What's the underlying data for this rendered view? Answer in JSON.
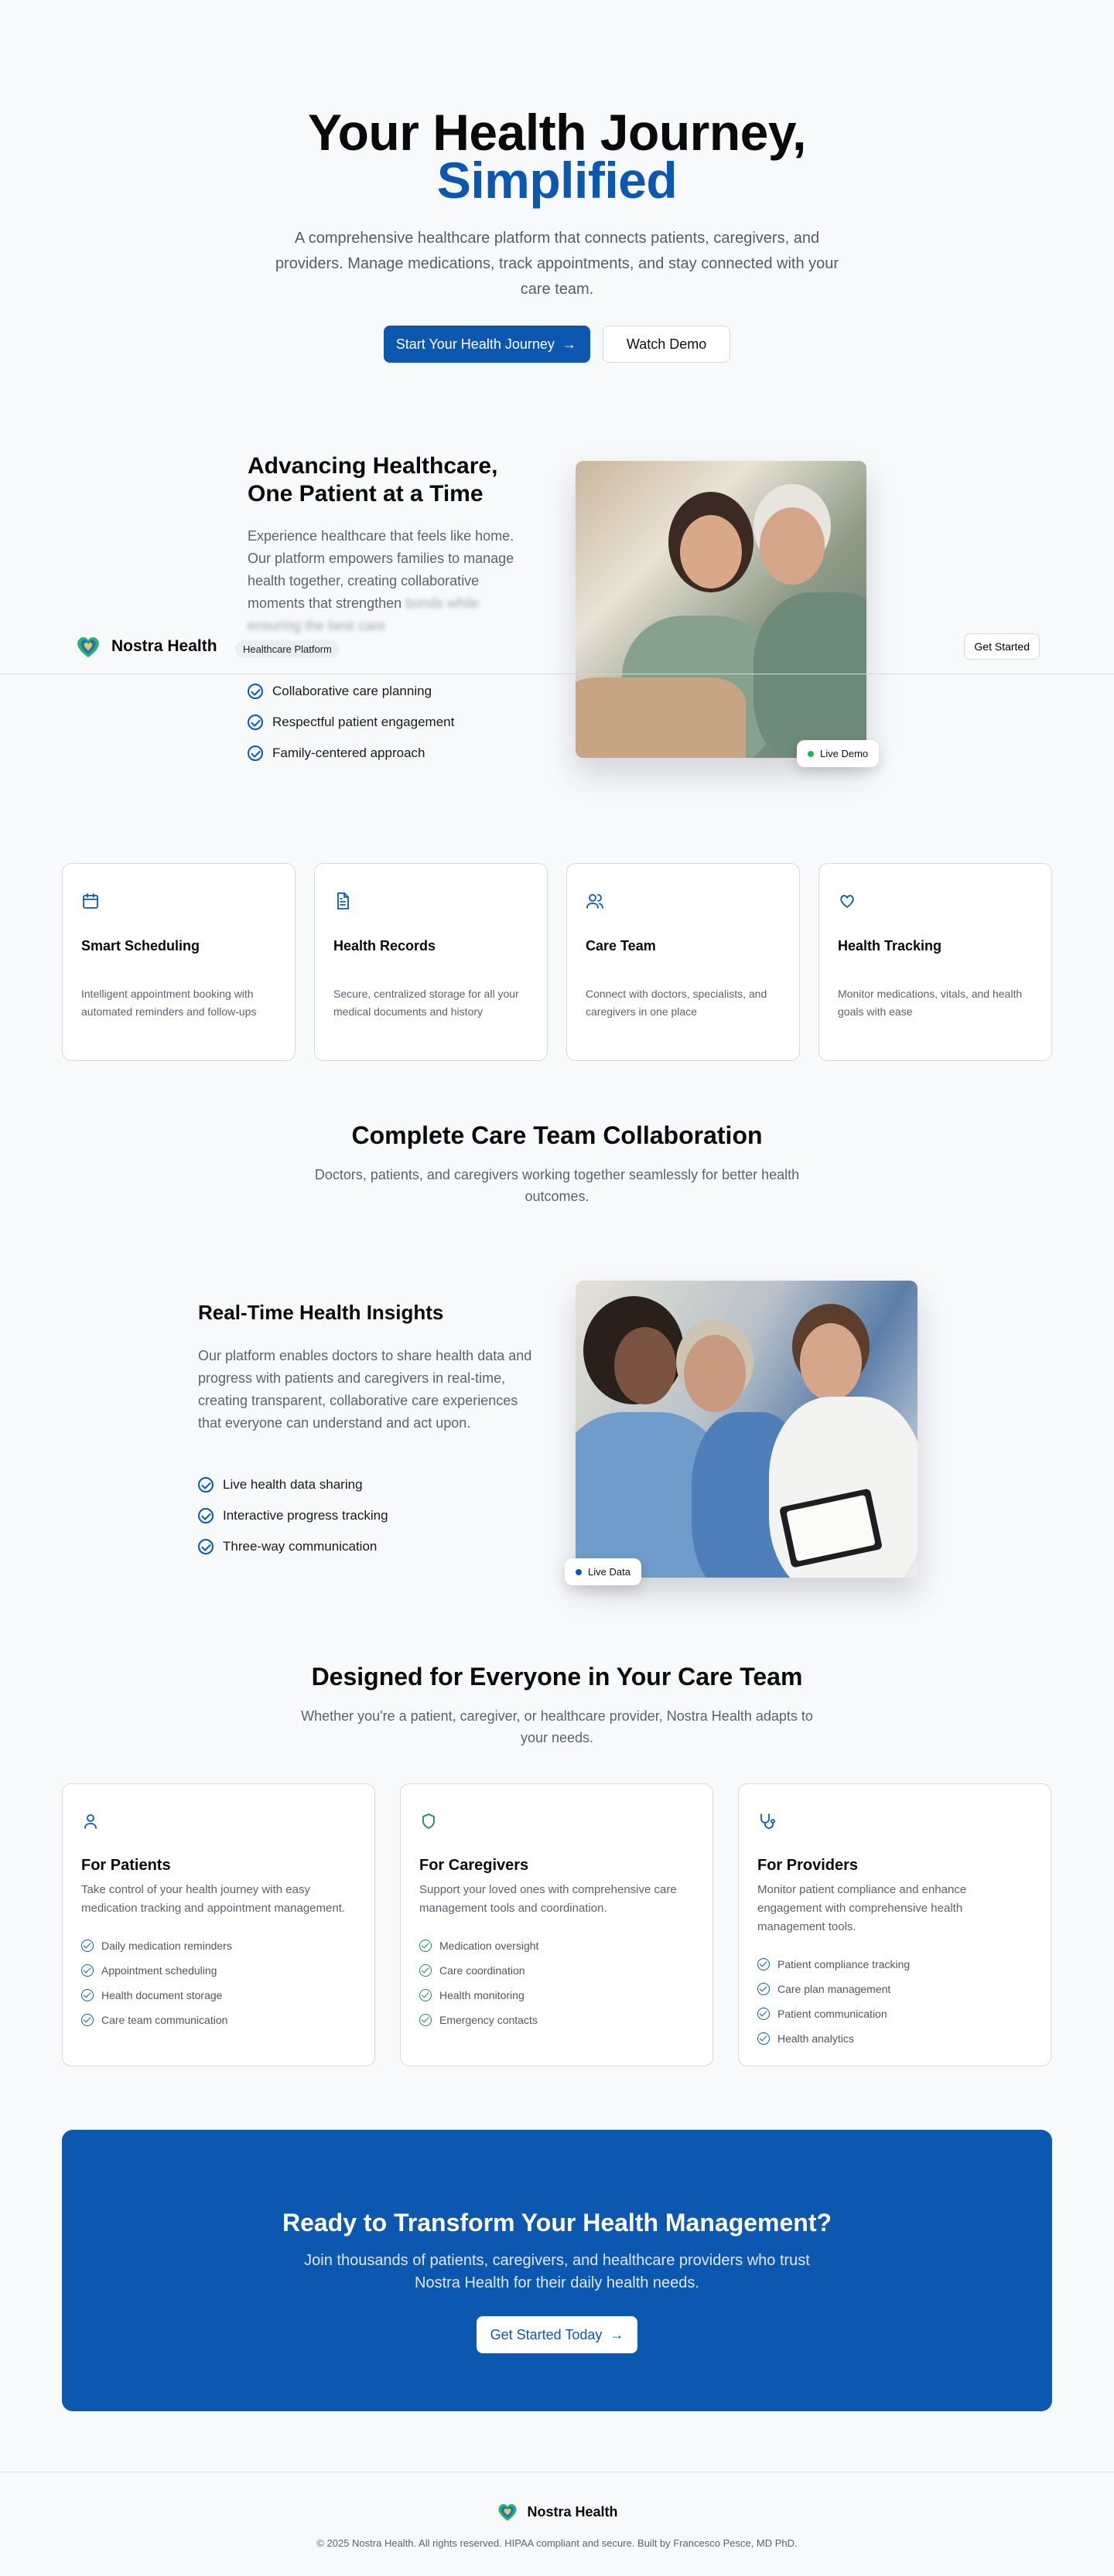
{
  "colors": {
    "accent": "#0c58b0",
    "live_green": "#22b35e",
    "check_green": "#1f8a56"
  },
  "hero": {
    "title_line1": "Your Health Journey,",
    "title_line2": "Simplified",
    "subtitle": "A comprehensive healthcare platform that connects patients, caregivers, and providers. Manage medications, track appointments, and stay connected with your care team.",
    "primary_cta": "Start Your Health Journey",
    "secondary_cta": "Watch Demo"
  },
  "nav": {
    "brand": "Nostra Health",
    "badge": "Healthcare Platform",
    "get_started": "Get Started"
  },
  "advancing": {
    "title": "Advancing Healthcare, One Patient at a Time",
    "body_visible": "Experience healthcare that feels like home. Our platform empowers families to manage health together, creating collaborative moments that strengthen",
    "body_faded": "bonds while ensuring the best care",
    "points": [
      "Collaborative care planning",
      "Respectful patient engagement",
      "Family-centered approach"
    ],
    "badge": "Live Demo"
  },
  "features": [
    {
      "icon": "calendar-icon",
      "title": "Smart Scheduling",
      "desc": "Intelligent appointment booking with automated reminders and follow-ups"
    },
    {
      "icon": "document-icon",
      "title": "Health Records",
      "desc": "Secure, centralized storage for all your medical documents and history"
    },
    {
      "icon": "users-icon",
      "title": "Care Team",
      "desc": "Connect with doctors, specialists, and caregivers in one place"
    },
    {
      "icon": "heart-icon",
      "title": "Health Tracking",
      "desc": "Monitor medications, vitals, and health goals with ease"
    }
  ],
  "collab": {
    "title": "Complete Care Team Collaboration",
    "subtitle": "Doctors, patients, and caregivers working together seamlessly for better health outcomes."
  },
  "insights": {
    "title": "Real-Time Health Insights",
    "body": "Our platform enables doctors to share health data and progress with patients and caregivers in real-time, creating transparent, collaborative care experiences that everyone can understand and act upon.",
    "points": [
      "Live health data sharing",
      "Interactive progress tracking",
      "Three-way communication"
    ],
    "badge": "Live Data"
  },
  "audience": {
    "title": "Designed for Everyone in Your Care Team",
    "subtitle": "Whether you're a patient, caregiver, or healthcare provider, Nostra Health adapts to your needs.",
    "cards": [
      {
        "icon": "user-icon",
        "title": "For Patients",
        "desc": "Take control of your health journey with easy medication tracking and appointment management.",
        "items": [
          "Daily medication reminders",
          "Appointment scheduling",
          "Health document storage",
          "Care team communication"
        ]
      },
      {
        "icon": "shield-icon",
        "title": "For Caregivers",
        "desc": "Support your loved ones with comprehensive care management tools and coordination.",
        "items": [
          "Medication oversight",
          "Care coordination",
          "Health monitoring",
          "Emergency contacts"
        ]
      },
      {
        "icon": "stethoscope-icon",
        "title": "For Providers",
        "desc": "Monitor patient compliance and enhance engagement with comprehensive health management tools.",
        "items": [
          "Patient compliance tracking",
          "Care plan management",
          "Patient communication",
          "Health analytics"
        ]
      }
    ]
  },
  "cta": {
    "title": "Ready to Transform Your Health Management?",
    "subtitle": "Join thousands of patients, caregivers, and healthcare providers who trust Nostra Health for their daily health needs.",
    "button": "Get Started Today"
  },
  "footer": {
    "brand": "Nostra Health",
    "copyright": "© 2025 Nostra Health. All rights reserved. HIPAA compliant and secure. Built by Francesco Pesce, MD PhD."
  }
}
